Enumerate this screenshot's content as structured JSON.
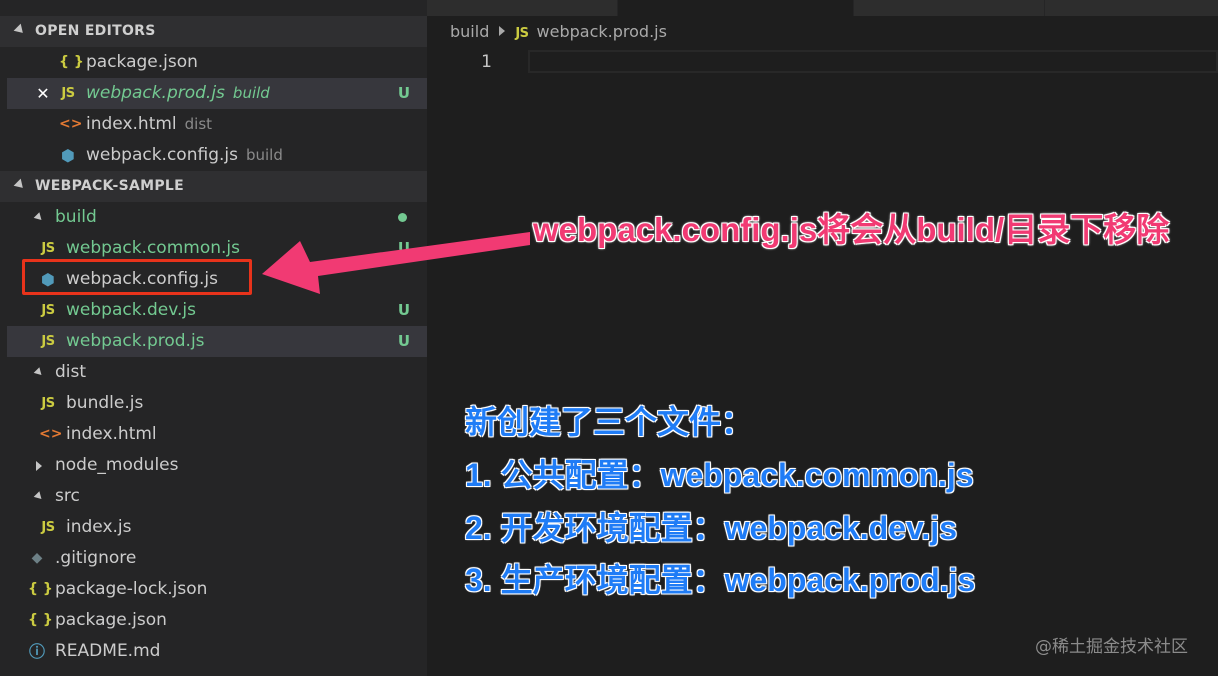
{
  "sidebar": {
    "open_editors_header": "OPEN EDITORS",
    "project_header": "WEBPACK-SAMPLE",
    "open_editors": [
      {
        "name": "package.json",
        "desc": "",
        "icon": "braces-icon",
        "badge": ""
      },
      {
        "name": "webpack.prod.js",
        "desc": "build",
        "icon": "js-icon",
        "badge": "U"
      },
      {
        "name": "index.html",
        "desc": "dist",
        "icon": "html-icon",
        "badge": ""
      },
      {
        "name": "webpack.config.js",
        "desc": "build",
        "icon": "webpack-cube-icon",
        "badge": ""
      }
    ],
    "tree": {
      "build_folder": "build",
      "build_files": [
        {
          "name": "webpack.common.js",
          "badge": "U"
        },
        {
          "name": "webpack.config.js",
          "badge": ""
        },
        {
          "name": "webpack.dev.js",
          "badge": "U"
        },
        {
          "name": "webpack.prod.js",
          "badge": "U"
        }
      ],
      "dist_folder": "dist",
      "dist_files": [
        {
          "name": "bundle.js"
        },
        {
          "name": "index.html"
        }
      ],
      "node_modules": "node_modules",
      "src_folder": "src",
      "src_files": [
        {
          "name": "index.js"
        }
      ],
      "root_files": [
        {
          "name": ".gitignore"
        },
        {
          "name": "package-lock.json"
        },
        {
          "name": "package.json"
        },
        {
          "name": "README.md"
        }
      ]
    },
    "icons": {
      "js": "JS",
      "braces": "{ }",
      "html": "<>",
      "close": "✕",
      "info": "ⓘ",
      "cube": "⬢",
      "git": "◆"
    }
  },
  "editor": {
    "breadcrumb": {
      "folder": "build",
      "file_icon": "JS",
      "file": "webpack.prod.js"
    },
    "line_number": "1"
  },
  "annotations": {
    "move_note": "webpack.config.js将会从build/目录下移除",
    "summary": [
      "新创建了三个文件：",
      "1. 公共配置：webpack.common.js",
      "2. 开发环境配置：webpack.dev.js",
      "3. 生产环境配置：webpack.prod.js"
    ]
  },
  "watermark": "@稀土掘金技术社区",
  "colors": {
    "sidebar_bg": "#252526",
    "editor_bg": "#1e1e1e",
    "untracked_green": "#73c991",
    "highlight_red": "#e8331b",
    "annotation_pink": "#f13a73",
    "annotation_blue": "#1f7cf6"
  }
}
